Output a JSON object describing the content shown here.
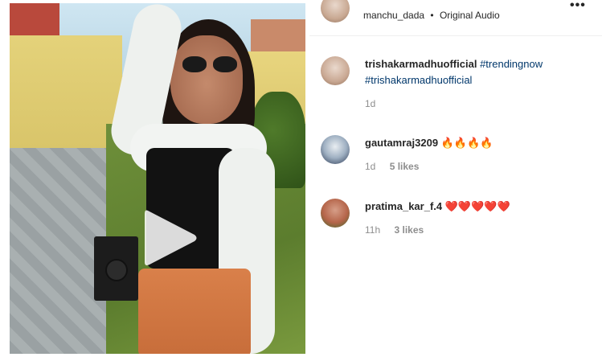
{
  "post": {
    "author": "manchu_dada",
    "separator": "•",
    "audio": "Original Audio",
    "more_label": "•••"
  },
  "comments": [
    {
      "username": "trishakarmadhuofficial",
      "hashtags": [
        "#trendingnow",
        "#trishakarmadhuofficial"
      ],
      "time": "1d"
    },
    {
      "username": "gautamraj3209",
      "text": "🔥🔥🔥🔥",
      "time": "1d",
      "likes": "5 likes"
    },
    {
      "username": "pratima_kar_f.4",
      "text": "❤️❤️❤️❤️❤️",
      "time": "11h",
      "likes": "3 likes"
    }
  ],
  "colors": {
    "text": "#262626",
    "muted": "#8e8e8e",
    "hashtag": "#00376b"
  },
  "icons": {
    "play": "play-icon",
    "more": "more-options-icon"
  }
}
